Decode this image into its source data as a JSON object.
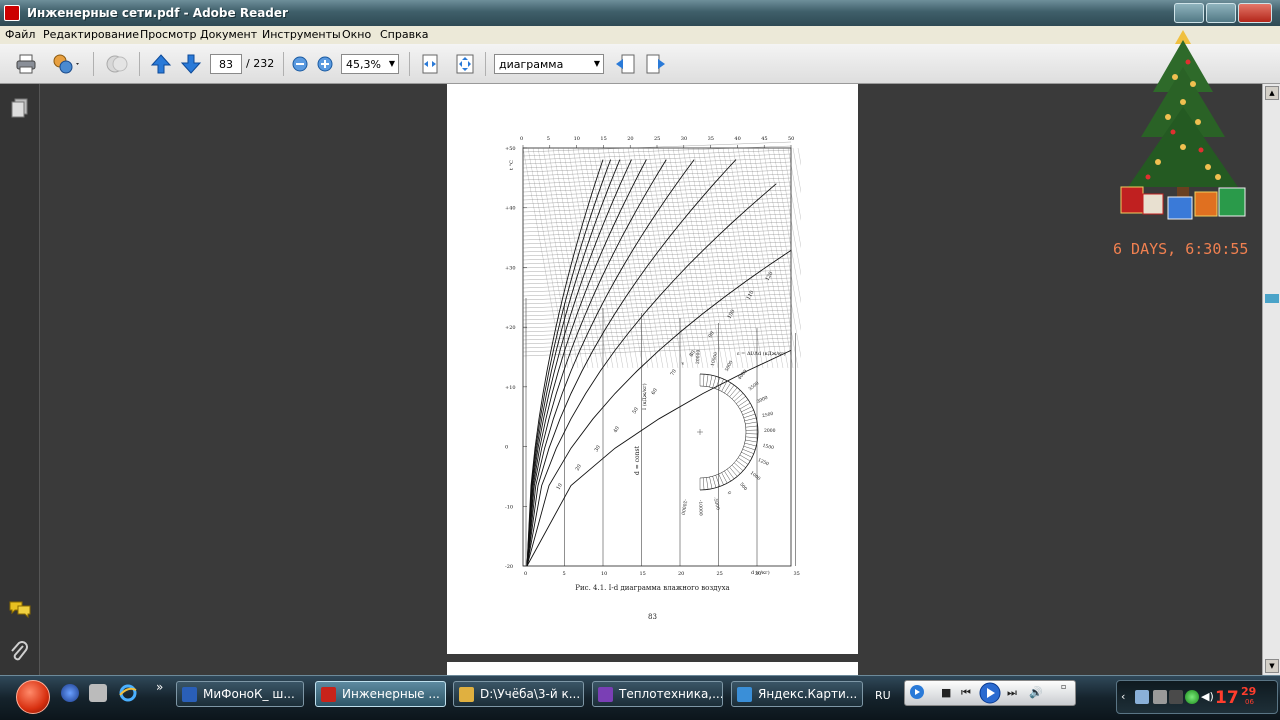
{
  "window": {
    "title": "Инженерные сети.pdf - Adobe Reader"
  },
  "menu": [
    "Файл",
    "Редактирование",
    "Просмотр",
    "Документ",
    "Инструменты",
    "Окно",
    "Справка"
  ],
  "toolbar": {
    "page_current": "83",
    "page_separator": "/",
    "page_total": "232",
    "zoom": "45,3%",
    "search_value": "диаграмма"
  },
  "document": {
    "figure": {
      "top_d_ticks": [
        "0",
        "5",
        "10",
        "15",
        "20",
        "25",
        "30",
        "35",
        "40",
        "45",
        "50"
      ],
      "t_label": "t °C",
      "t_ticks": [
        "+50",
        "+40",
        "+30",
        "+20",
        "+10",
        "0",
        "-10",
        "-20"
      ],
      "bottom_d_ticks": [
        "0",
        "5",
        "10",
        "15",
        "20",
        "25",
        "30",
        "35"
      ],
      "d_axis_label": "d (г/кг)",
      "i_label": "I (кДж/кг)",
      "i_ticks": [
        "10",
        "20",
        "30",
        "40",
        "50",
        "60",
        "70",
        "80",
        "90",
        "100",
        "110",
        "120"
      ],
      "d_const_label": "d = const",
      "epsilon_label": "ε = ΔI/Δd (кДж/кг)",
      "epsilon_ticks": [
        "∞",
        "20000",
        "10000",
        "5000",
        "4000",
        "3500",
        "3000",
        "2500",
        "2000",
        "1500",
        "1250",
        "1000",
        "500",
        "0",
        "-5000",
        "-10000",
        "-20000"
      ],
      "caption": "Рис. 4.1. I-d диаграмма влажного воздуха"
    },
    "page_number": "83"
  },
  "desktop": {
    "countdown": "6 DAYS, 6:30:55"
  },
  "taskbar": {
    "tasks": [
      {
        "label": "МиФоноК_ ш...",
        "color": "#2a5fb8",
        "active": false
      },
      {
        "label": "Инженерные ...",
        "color": "#c8231a",
        "active": true
      },
      {
        "label": "D:\\Учёба\\3-й к...",
        "color": "#e0b040",
        "active": false
      },
      {
        "label": "Теплотехника,...",
        "color": "#7a3fb5",
        "active": false
      },
      {
        "label": "Яндекс.Карти...",
        "color": "#3a8fd8",
        "active": false
      }
    ],
    "language": "RU",
    "clock": {
      "hours": "17",
      "minutes": "29",
      "seconds": "06"
    }
  }
}
